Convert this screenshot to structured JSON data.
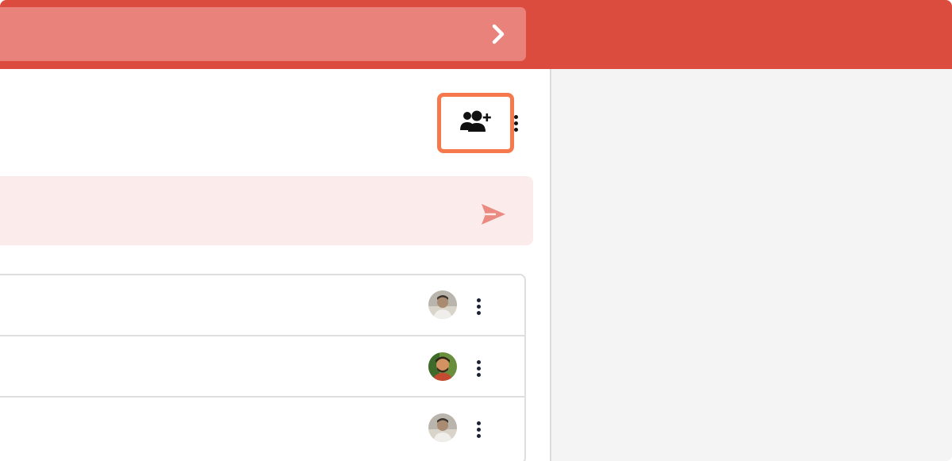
{
  "header": {
    "search_placeholder": "",
    "chevron_icon": "chevron-right-icon"
  },
  "toolbar": {
    "add_member_icon": "user-plus-icon",
    "more_icon": "more-vertical-icon"
  },
  "composer": {
    "placeholder": "",
    "send_icon": "send-icon"
  },
  "list": {
    "items": [
      {
        "avatar": "avatar-gray",
        "menu_icon": "more-vertical-icon"
      },
      {
        "avatar": "avatar-color",
        "menu_icon": "more-vertical-icon"
      },
      {
        "avatar": "avatar-gray",
        "menu_icon": "more-vertical-icon"
      }
    ]
  },
  "colors": {
    "header_bg": "#dc4c3e",
    "header_input_bg": "#e8827a",
    "highlight_border": "#f5794c",
    "composer_bg": "#fbebea",
    "send_icon": "#ea8a80"
  }
}
